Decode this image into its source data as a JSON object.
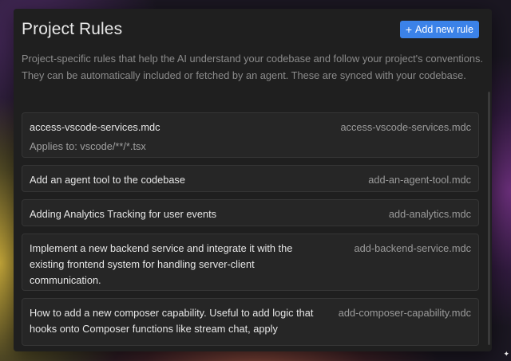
{
  "panel": {
    "title": "Project Rules",
    "add_button_label": "Add new rule",
    "add_button_icon": "plus-icon",
    "description": "Project-specific rules that help the AI understand your codebase and follow your project's conventions. They can be automatically included or fetched by an agent. These are synced with your codebase."
  },
  "rules": [
    {
      "name": "access-vscode-services.mdc",
      "applies": "Applies to: vscode/**/*.tsx",
      "file": "access-vscode-services.mdc"
    },
    {
      "name": "Add an agent tool to the codebase",
      "file": "add-an-agent-tool.mdc"
    },
    {
      "name": "Adding Analytics Tracking for user events",
      "file": "add-analytics.mdc"
    },
    {
      "name": "Implement a new backend service and integrate it with the existing frontend system for handling server-client communication.",
      "file": "add-backend-service.mdc"
    },
    {
      "name": "How to add a new composer capability. Useful to add logic that hooks onto Composer functions like stream chat, apply",
      "file": "add-composer-capability.mdc"
    }
  ],
  "colors": {
    "accent": "#3b82e8",
    "panel_bg": "#1f1f1f",
    "card_bg": "#262626"
  }
}
